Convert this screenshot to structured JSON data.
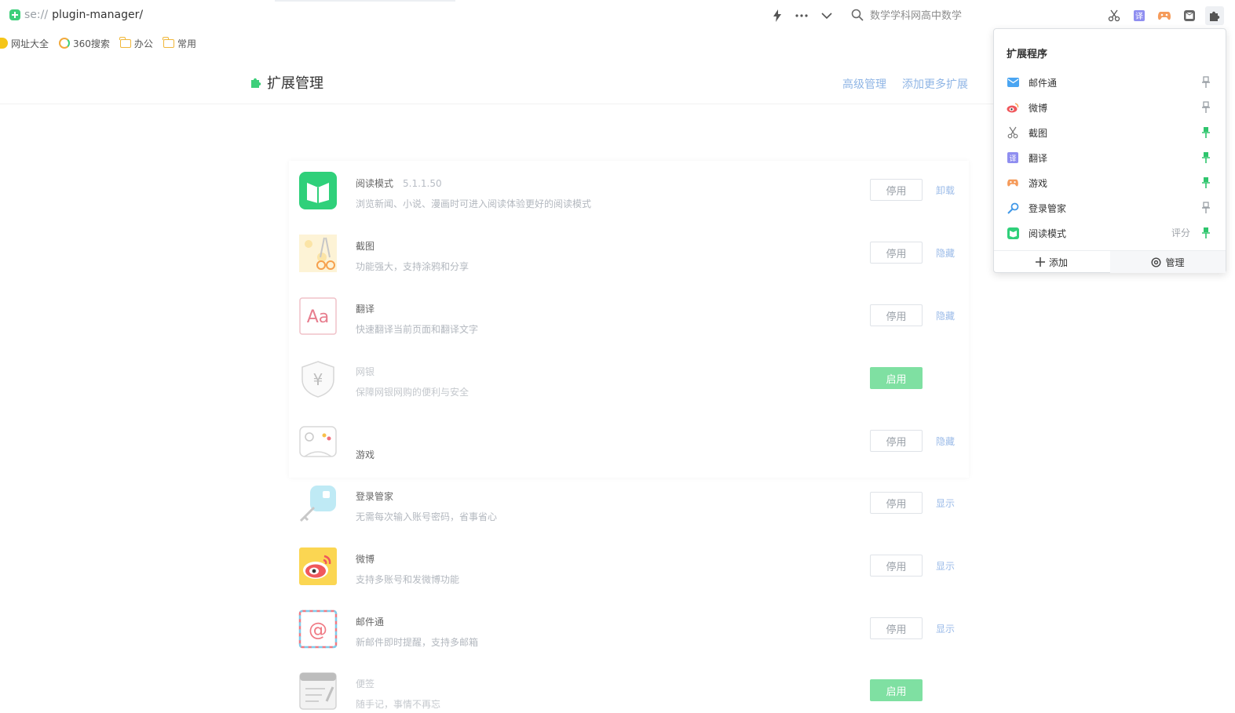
{
  "address_bar": {
    "scheme": "se://",
    "path": "plugin-manager/"
  },
  "toolbar": {
    "search_text": "数学学科网高中数学"
  },
  "bookmarks": [
    {
      "label": "网址大全",
      "icon": "smile-icon"
    },
    {
      "label": "360搜索",
      "icon": "ring-icon"
    },
    {
      "label": "办公",
      "icon": "folder-icon"
    },
    {
      "label": "常用",
      "icon": "folder-icon"
    }
  ],
  "page": {
    "title": "扩展管理",
    "links": {
      "advanced": "高级管理",
      "add_more": "添加更多扩展"
    }
  },
  "extensions": [
    {
      "name": "阅读模式",
      "version": "5.1.1.50",
      "desc": "浏览新闻、小说、漫画时可进入阅读体验更好的阅读模式",
      "button": "停用",
      "action": "卸载",
      "enabled": true
    },
    {
      "name": "截图",
      "version": "",
      "desc": "功能强大，支持涂鸦和分享",
      "button": "停用",
      "action": "隐藏",
      "enabled": true
    },
    {
      "name": "翻译",
      "version": "",
      "desc": "快速翻译当前页面和翻译文字",
      "button": "停用",
      "action": "隐藏",
      "enabled": true
    },
    {
      "name": "网银",
      "version": "",
      "desc": "保障网银网购的便利与安全",
      "button": "启用",
      "action": "",
      "enabled": false
    },
    {
      "name": "游戏",
      "version": "",
      "desc": "",
      "button": "停用",
      "action": "隐藏",
      "enabled": true
    },
    {
      "name": "登录管家",
      "version": "",
      "desc": "无需每次输入账号密码，省事省心",
      "button": "停用",
      "action": "显示",
      "enabled": true
    },
    {
      "name": "微博",
      "version": "",
      "desc": "支持多账号和发微博功能",
      "button": "停用",
      "action": "显示",
      "enabled": true
    },
    {
      "name": "邮件通",
      "version": "",
      "desc": "新邮件即时提醒，支持多邮箱",
      "button": "停用",
      "action": "显示",
      "enabled": true
    },
    {
      "name": "便签",
      "version": "",
      "desc": "随手记，事情不再忘",
      "button": "启用",
      "action": "",
      "enabled": false
    }
  ],
  "popup": {
    "title": "扩展程序",
    "items": [
      {
        "label": "邮件通",
        "icon": "mail-icon",
        "pinned": false,
        "extra": ""
      },
      {
        "label": "微博",
        "icon": "weibo-icon",
        "pinned": false,
        "extra": ""
      },
      {
        "label": "截图",
        "icon": "scissors-icon",
        "pinned": true,
        "extra": ""
      },
      {
        "label": "翻译",
        "icon": "translate-icon",
        "pinned": true,
        "extra": ""
      },
      {
        "label": "游戏",
        "icon": "gamepad-icon",
        "pinned": true,
        "extra": ""
      },
      {
        "label": "登录管家",
        "icon": "key-icon",
        "pinned": false,
        "extra": ""
      },
      {
        "label": "阅读模式",
        "icon": "book-icon",
        "pinned": true,
        "extra": "评分"
      }
    ],
    "add_label": "添加",
    "manage_label": "管理"
  },
  "colors": {
    "accent_green": "#3dcf7a",
    "link_blue": "#8fb5e5",
    "enable_button": "#7fe0a2"
  }
}
